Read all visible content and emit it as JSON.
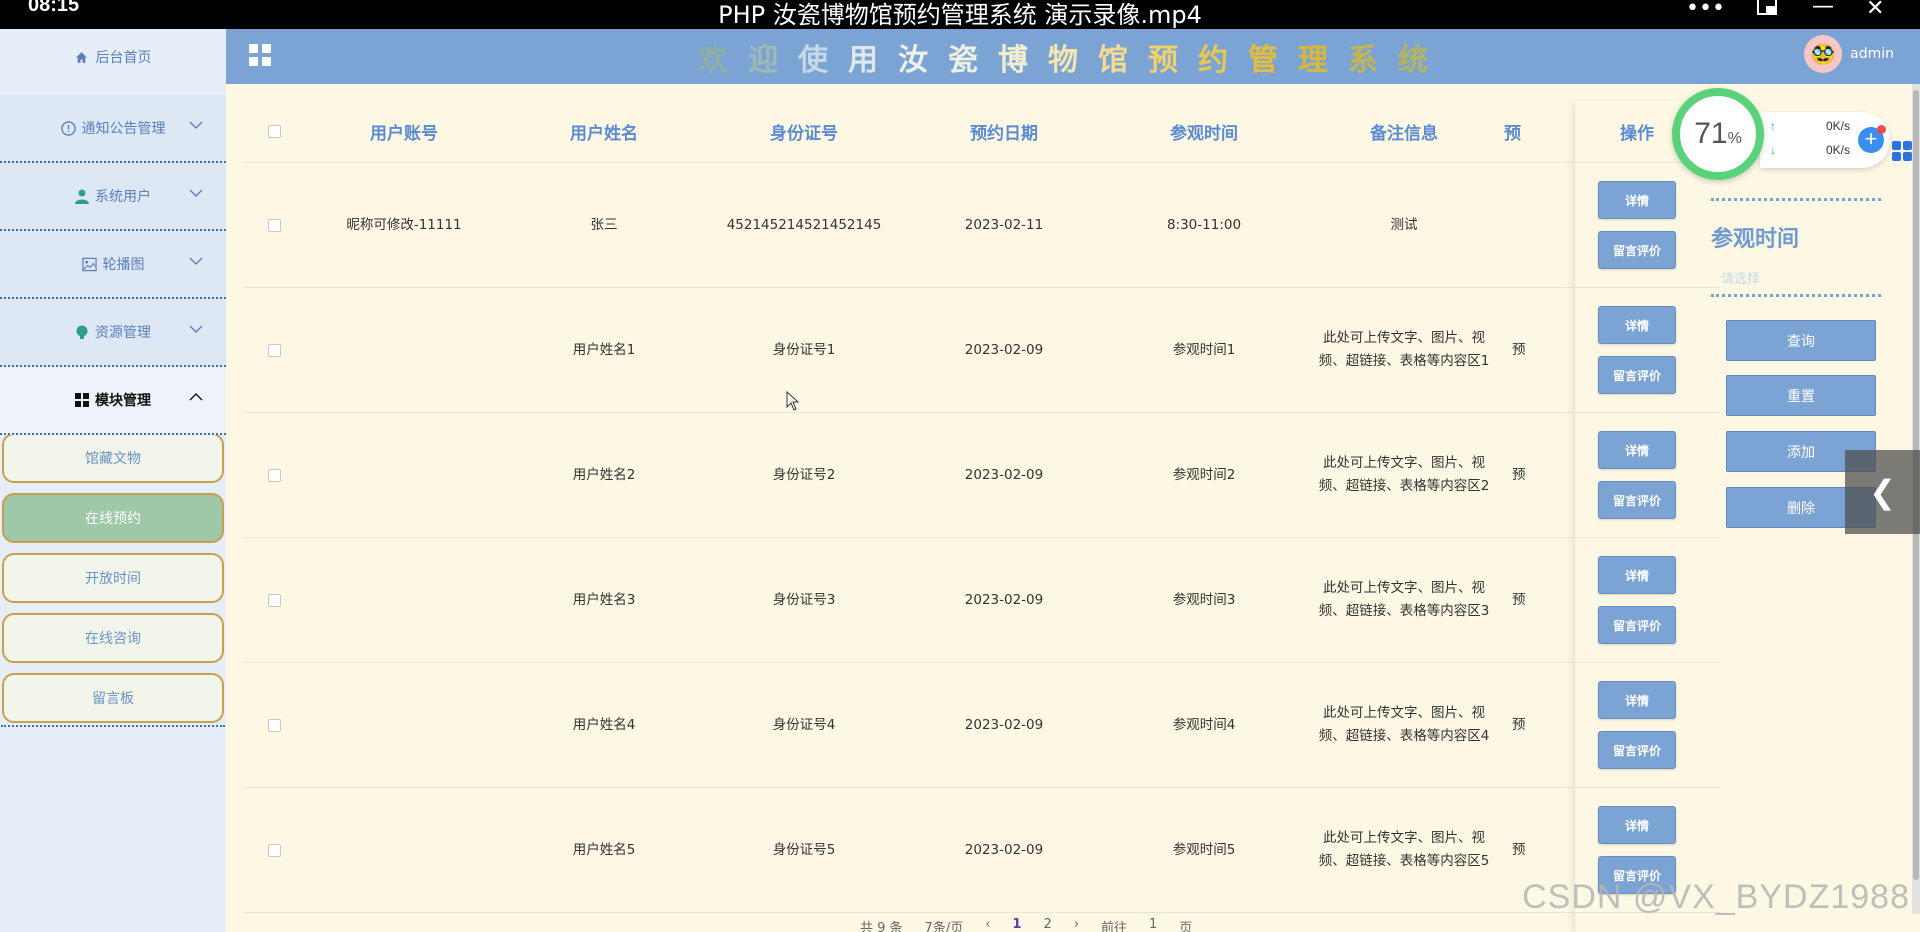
{
  "player": {
    "time": "08:15",
    "title": "PHP 汝瓷博物馆预约管理系统 演示录像.mp4"
  },
  "sidebar": {
    "home": "后台首页",
    "groups": [
      {
        "label": "通知公告管理",
        "icon": "info-icon"
      },
      {
        "label": "系统用户",
        "icon": "user-icon"
      },
      {
        "label": "轮播图",
        "icon": "image-icon"
      },
      {
        "label": "资源管理",
        "icon": "bulb-icon"
      },
      {
        "label": "模块管理",
        "icon": "grid-icon"
      }
    ],
    "sub_items": [
      "馆藏文物",
      "在线预约",
      "开放时间",
      "在线咨询",
      "留言板"
    ],
    "active_sub": "在线预约"
  },
  "header": {
    "welcome_chars": [
      "欢",
      "迎",
      "使",
      "用",
      "汝",
      "瓷",
      "博",
      "物",
      "馆",
      "预",
      "约",
      "管",
      "理",
      "系",
      "统"
    ],
    "welcome_colors": [
      "#8fb0a0",
      "#9fb8b8",
      "#c7d8e6",
      "#e0e8ee",
      "#eef0ea",
      "#eef1e2",
      "#f2efcf",
      "#f2e7b0",
      "#f2dd8e",
      "#f0d26c",
      "#e9c752",
      "#e4bd3a",
      "#d8b83c",
      "#c6b650",
      "#b5b460"
    ],
    "username": "admin"
  },
  "table": {
    "headers": [
      "用户账号",
      "用户姓名",
      "身份证号",
      "预约日期",
      "参观时间",
      "备注信息",
      "预",
      "操作"
    ],
    "rows": [
      {
        "account": "昵称可修改-11111",
        "name": "张三",
        "id": "452145214521452145",
        "date": "2023-02-11",
        "time": "8:30-11:00",
        "note": "测试",
        "extra": ""
      },
      {
        "account": "",
        "name": "用户姓名1",
        "id": "身份证号1",
        "date": "2023-02-09",
        "time": "参观时间1",
        "note": "此处可上传文字、图片、视频、超链接、表格等内容区1",
        "extra": "预"
      },
      {
        "account": "",
        "name": "用户姓名2",
        "id": "身份证号2",
        "date": "2023-02-09",
        "time": "参观时间2",
        "note": "此处可上传文字、图片、视频、超链接、表格等内容区2",
        "extra": "预"
      },
      {
        "account": "",
        "name": "用户姓名3",
        "id": "身份证号3",
        "date": "2023-02-09",
        "time": "参观时间3",
        "note": "此处可上传文字、图片、视频、超链接、表格等内容区3",
        "extra": "预"
      },
      {
        "account": "",
        "name": "用户姓名4",
        "id": "身份证号4",
        "date": "2023-02-09",
        "time": "参观时间4",
        "note": "此处可上传文字、图片、视频、超链接、表格等内容区4",
        "extra": "预"
      },
      {
        "account": "",
        "name": "用户姓名5",
        "id": "身份证号5",
        "date": "2023-02-09",
        "time": "参观时间5",
        "note": "此处可上传文字、图片、视频、超链接、表格等内容区5",
        "extra": "预"
      }
    ],
    "detail_btn": "详情",
    "comment_btn": "留言评价"
  },
  "search": {
    "title": "参观时间",
    "placeholder": "请选择",
    "buttons": [
      "查询",
      "重置",
      "添加",
      "删除"
    ]
  },
  "pager": {
    "total": "共 9 条",
    "per_page": "7条/页",
    "pages": [
      "1",
      "2"
    ],
    "current": "1",
    "goto_label": "前往",
    "goto_value": "1",
    "page_unit": "页"
  },
  "speed": {
    "percent": "71",
    "percent_sign": "%",
    "up": "0K/s",
    "down": "0K/s"
  },
  "watermark": "CSDN @VX_BYDZ1988"
}
